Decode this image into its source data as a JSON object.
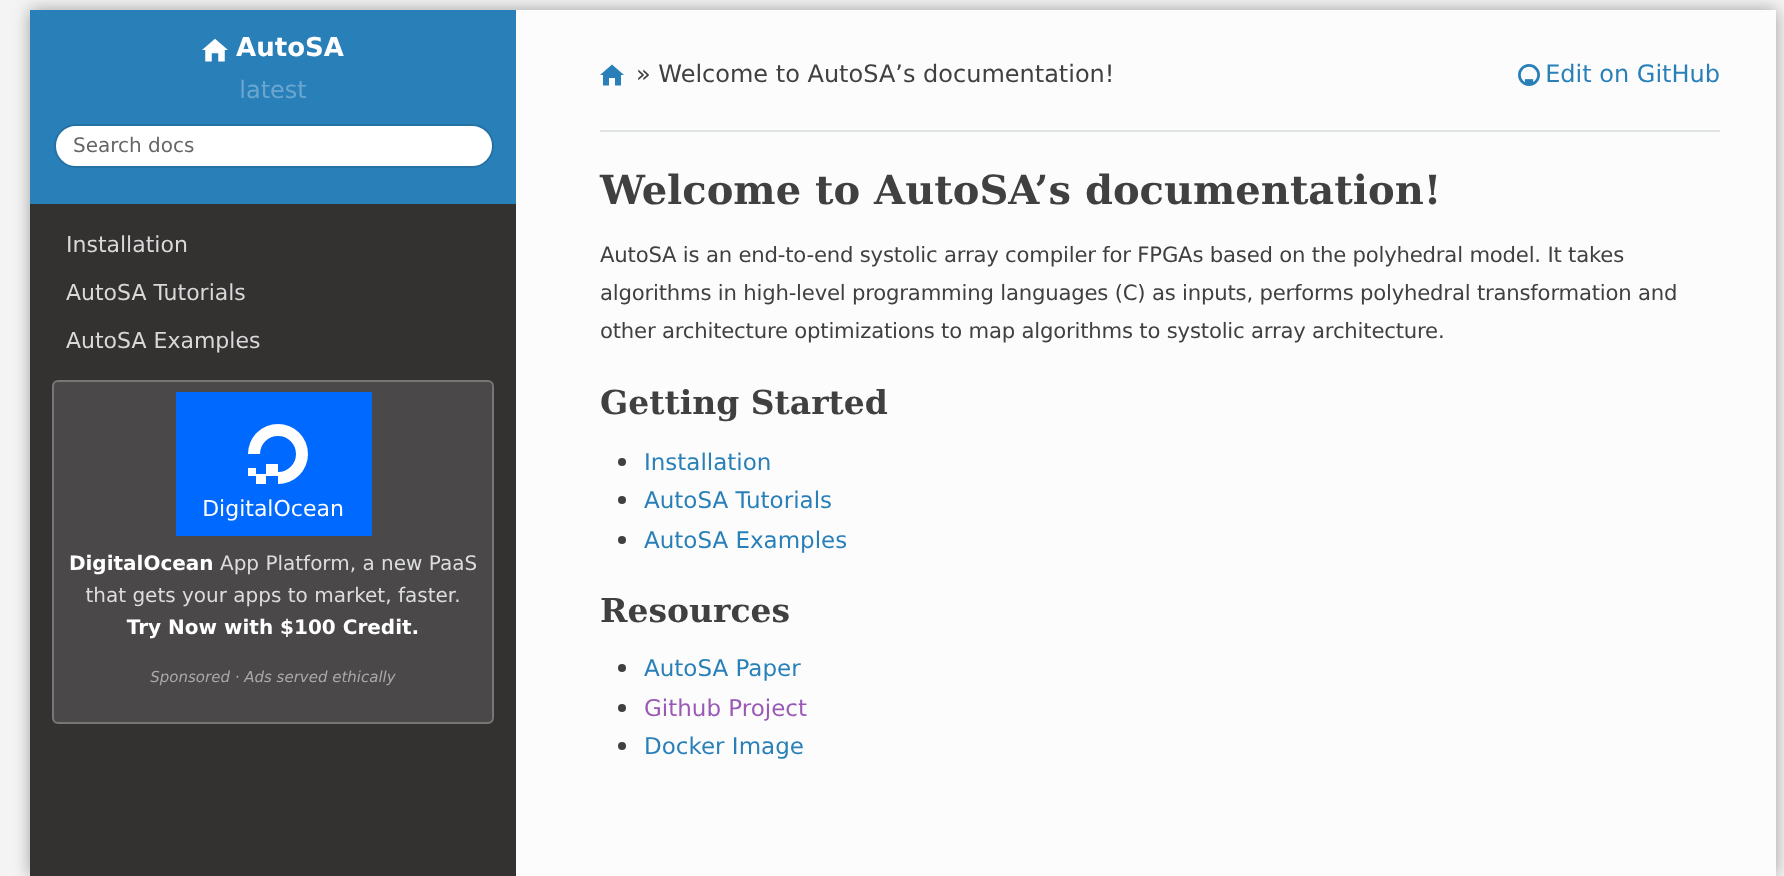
{
  "sidebar": {
    "project": "AutoSA",
    "version": "latest",
    "search": {
      "placeholder": "Search docs"
    },
    "items": [
      {
        "label": "Installation"
      },
      {
        "label": "AutoSA Tutorials"
      },
      {
        "label": "AutoSA Examples"
      }
    ],
    "ad": {
      "logo_text": "DigitalOcean",
      "text": "**DigitalOcean** App Platform, a new PaaS that gets your apps to market, faster. **Try Now with $100 Credit.**",
      "note": "Sponsored · Ads served ethically"
    }
  },
  "breadcrumb": {
    "separator": "»",
    "current": "Welcome to AutoSA’s documentation!",
    "edit_link": "Edit on GitHub"
  },
  "title": "Welcome to AutoSA’s documentation!",
  "intro": "AutoSA is an end-to-end systolic array compiler for FPGAs based on the polyhedral model. It takes algorithms in high-level programming languages (C) as inputs, performs polyhedral transformation and other architecture optimizations to map algorithms to systolic array architecture.",
  "sections": [
    {
      "heading": "Getting Started",
      "links": [
        {
          "label": "Installation",
          "visited": false
        },
        {
          "label": "AutoSA Tutorials",
          "visited": false
        },
        {
          "label": "AutoSA Examples",
          "visited": false
        }
      ]
    },
    {
      "heading": "Resources",
      "links": [
        {
          "label": "AutoSA Paper",
          "visited": false
        },
        {
          "label": "Github Project",
          "visited": true
        },
        {
          "label": "Docker Image",
          "visited": false
        }
      ]
    }
  ]
}
